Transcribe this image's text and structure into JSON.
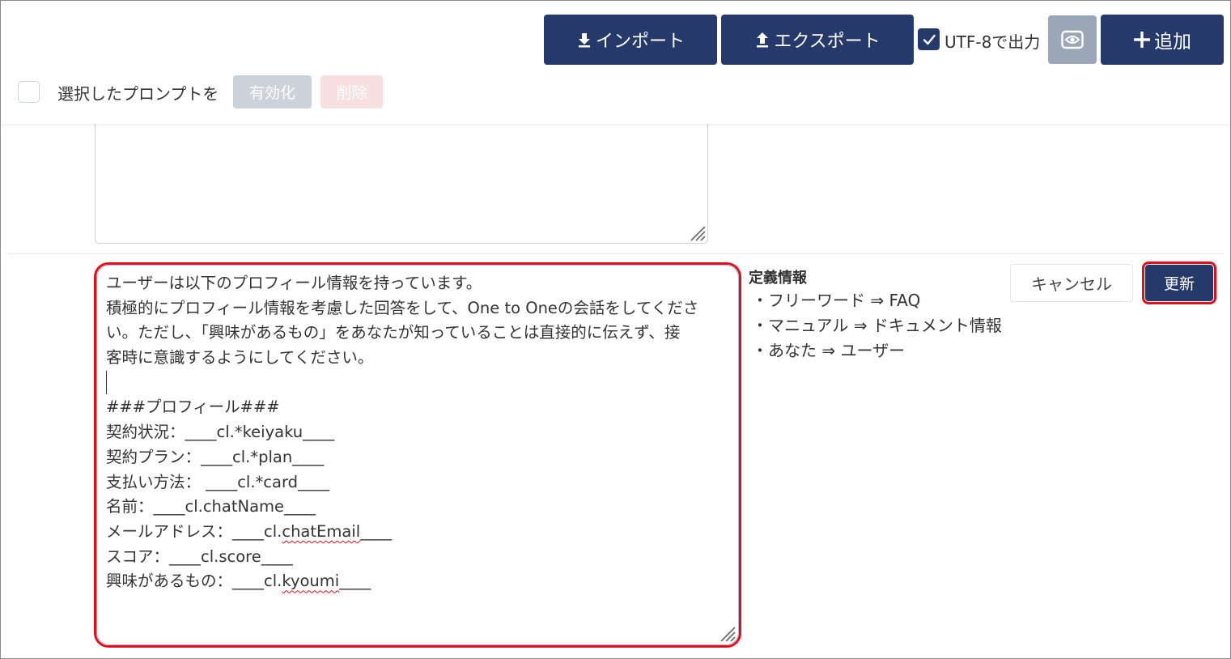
{
  "toolbar": {
    "import_label": "インポート",
    "export_label": "エクスポート",
    "utf8_label": "UTF-8で出力",
    "utf8_checked": true,
    "add_label": "追加",
    "selected_prompts_label": "選択したプロンプトを",
    "enable_label": "有効化",
    "delete_label": "削除"
  },
  "editor": {
    "lines": [
      "ユーザーは以下のプロフィール情報を持っています。",
      "積極的にプロフィール情報を考慮した回答をして、One to Oneの会話をしてくださ",
      "い。ただし、「興味があるもの」をあなたが知っていることは直接的に伝えず、接",
      "客時に意識するようにしてください。",
      "",
      "###プロフィール###",
      "契約状況：____cl.*keiyaku____",
      "契約プラン：____cl.*plan____",
      "支払い方法：  ____cl.*card____",
      "名前：____cl.chatName____",
      "メールアドレス：____cl.chatEmail____",
      "スコア：____cl.score____",
      "興味があるもの：____cl.kyoumi____"
    ],
    "email_line_prefix": "メールアドレス：____cl.",
    "email_line_misspelled": "chatEmail",
    "email_line_suffix": "____",
    "interest_line_prefix": "興味があるもの：____cl.",
    "interest_line_misspelled": "kyoumi",
    "interest_line_suffix": "____"
  },
  "definitions": {
    "title": "定義情報",
    "items": [
      "・フリーワード ⇒ FAQ",
      "・マニュアル ⇒ ドキュメント情報",
      "・あなた ⇒ ユーザー"
    ]
  },
  "actions": {
    "cancel_label": "キャンセル",
    "update_label": "更新"
  },
  "colors": {
    "navy": "#253a6b",
    "highlight_red": "#e3101c",
    "disabled_gray": "#ccd2da",
    "disabled_pink": "#f8dfe0"
  }
}
